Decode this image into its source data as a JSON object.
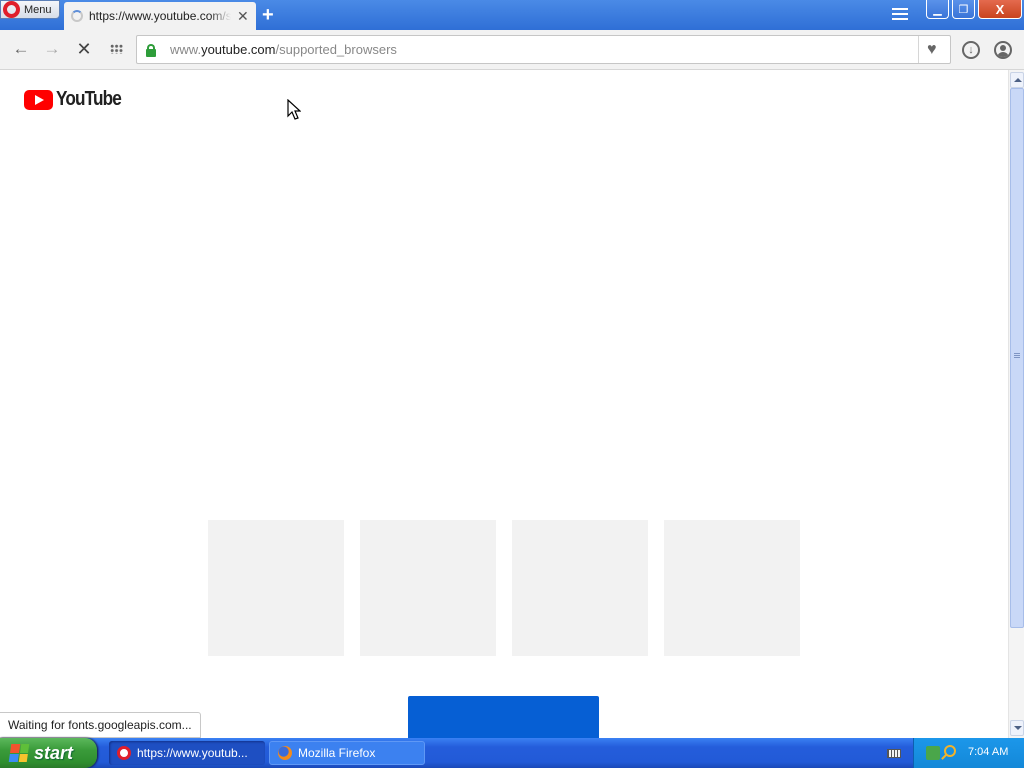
{
  "window": {
    "menu_label": "Menu",
    "active_tab_title": "https://www.youtube.com/supported_browsers",
    "new_tab_symbol": "+",
    "tab_close_symbol": "✕",
    "minimize_symbol": "▁",
    "restore_symbol": "❐",
    "close_symbol": "X"
  },
  "toolbar": {
    "back_symbol": "←",
    "forward_symbol": "→",
    "stop_symbol": "✕",
    "url_prefix": "www.",
    "url_host": "youtube.com",
    "url_path": "/supported_browsers",
    "heart_symbol": "♥",
    "download_symbol": "↓"
  },
  "page": {
    "logo_text": "YouTube",
    "status_text": "Waiting for fonts.googleapis.com..."
  },
  "taskbar": {
    "start_label": "start",
    "tasks": [
      {
        "label": "https://www.youtub...",
        "icon": "opera-icon",
        "active": true
      },
      {
        "label": "Mozilla Firefox",
        "icon": "firefox-icon",
        "active": false
      }
    ],
    "clock": "7:04 AM"
  },
  "colors": {
    "titlebar": "#3a7de0",
    "youtube_red": "#ff0000",
    "blue_button": "#065fd4",
    "placeholder_card": "#f2f2f2",
    "start_green": "#3a9b3a",
    "lock_green": "#2e9d3a"
  }
}
